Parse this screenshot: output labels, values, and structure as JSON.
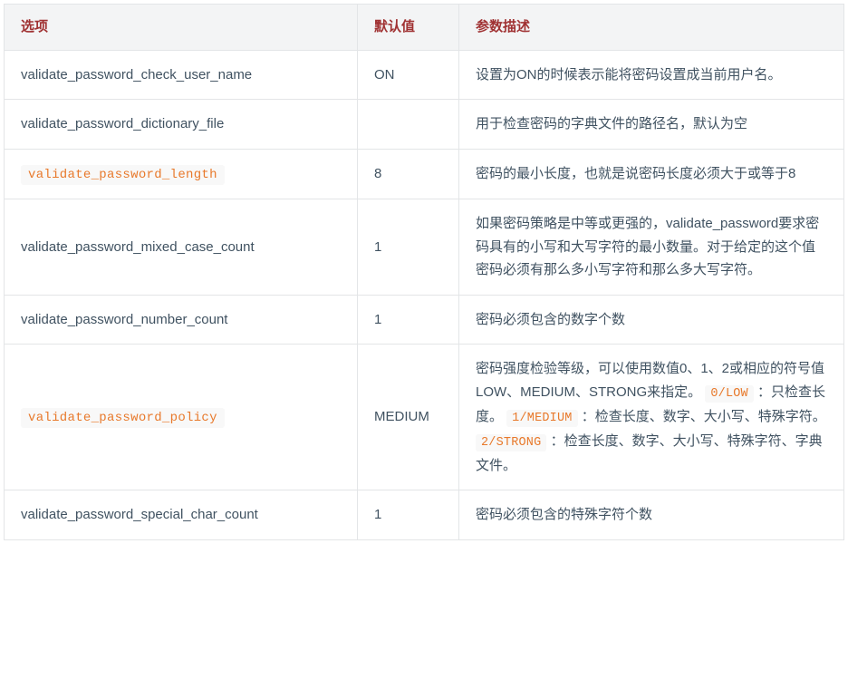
{
  "table": {
    "headers": {
      "option": "选项",
      "default": "默认值",
      "description": "参数描述"
    },
    "rows": [
      {
        "option": "validate_password_check_user_name",
        "option_is_code": false,
        "default": "ON",
        "desc_segments": [
          {
            "type": "text",
            "value": "设置为ON的时候表示能将密码设置成当前用户名。"
          }
        ]
      },
      {
        "option": "validate_password_dictionary_file",
        "option_is_code": false,
        "default": "",
        "desc_segments": [
          {
            "type": "text",
            "value": "用于检查密码的字典文件的路径名，默认为空"
          }
        ]
      },
      {
        "option": "validate_password_length",
        "option_is_code": true,
        "default": "8",
        "desc_segments": [
          {
            "type": "text",
            "value": "密码的最小长度，也就是说密码长度必须大于或等于8"
          }
        ]
      },
      {
        "option": "validate_password_mixed_case_count",
        "option_is_code": false,
        "default": "1",
        "desc_segments": [
          {
            "type": "text",
            "value": "如果密码策略是中等或更强的，validate_password要求密码具有的小写和大写字符的最小数量。对于给定的这个值密码必须有那么多小写字符和那么多大写字符。"
          }
        ]
      },
      {
        "option": "validate_password_number_count",
        "option_is_code": false,
        "default": "1",
        "desc_segments": [
          {
            "type": "text",
            "value": "密码必须包含的数字个数"
          }
        ]
      },
      {
        "option": "validate_password_policy",
        "option_is_code": true,
        "default": "MEDIUM",
        "desc_segments": [
          {
            "type": "text",
            "value": "密码强度检验等级，可以使用数值0、1、2或相应的符号值LOW、MEDIUM、STRONG来指定。 "
          },
          {
            "type": "code",
            "value": "0/LOW"
          },
          {
            "type": "text",
            "value": " ：只检查长度。 "
          },
          {
            "type": "code",
            "value": "1/MEDIUM"
          },
          {
            "type": "text",
            "value": " ：检查长度、数字、大小写、特殊字符。 "
          },
          {
            "type": "code",
            "value": "2/STRONG"
          },
          {
            "type": "text",
            "value": " ：检查长度、数字、大小写、特殊字符、字典文件。"
          }
        ]
      },
      {
        "option": "validate_password_special_char_count",
        "option_is_code": false,
        "default": "1",
        "desc_segments": [
          {
            "type": "text",
            "value": "密码必须包含的特殊字符个数"
          }
        ]
      }
    ]
  }
}
